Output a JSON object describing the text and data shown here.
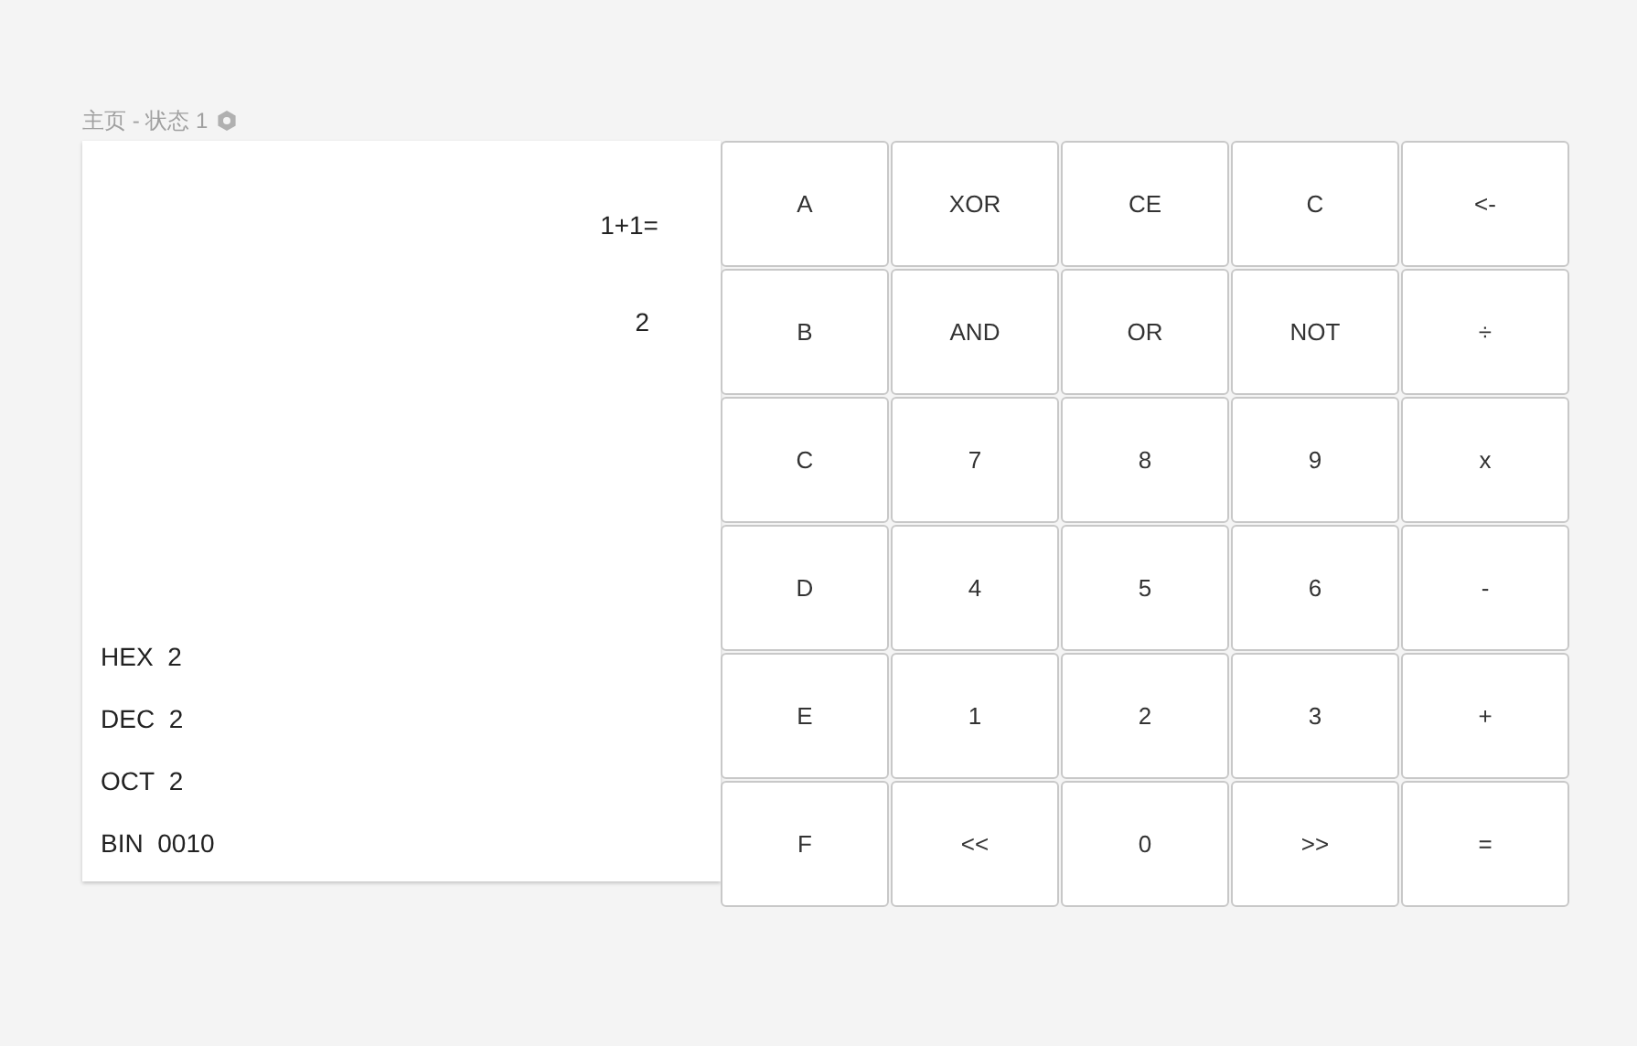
{
  "page_title": "主页 - 状态 1",
  "display": {
    "expression": "1+1=",
    "result": "2"
  },
  "bases": [
    {
      "label": "HEX",
      "value": "2"
    },
    {
      "label": "DEC",
      "value": "2"
    },
    {
      "label": "OCT",
      "value": "2"
    },
    {
      "label": "BIN",
      "value": "0010"
    }
  ],
  "keys": [
    "A",
    "XOR",
    "CE",
    "C",
    "<-",
    "B",
    "AND",
    "OR",
    "NOT",
    "÷",
    "C",
    "7",
    "8",
    "9",
    "x",
    "D",
    "4",
    "5",
    "6",
    "-",
    "E",
    "1",
    "2",
    "3",
    "+",
    "F",
    "<<",
    "0",
    ">>",
    "="
  ]
}
